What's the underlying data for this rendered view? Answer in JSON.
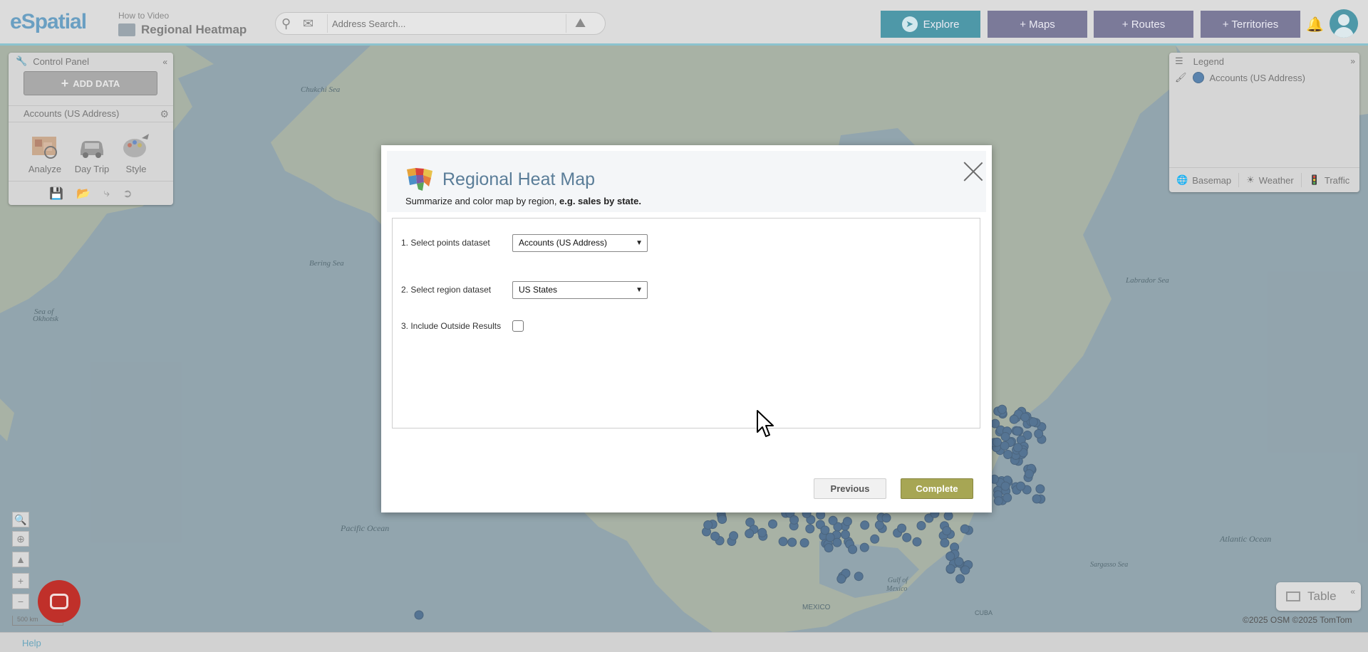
{
  "header": {
    "logo": "eSpatial",
    "video_subtitle": "How to Video",
    "video_title": "Regional Heatmap",
    "search_placeholder": "Address Search...",
    "nav": {
      "explore": "Explore",
      "maps": "+ Maps",
      "routes": "+ Routes",
      "territories": "+ Territories"
    }
  },
  "control_panel": {
    "title": "Control Panel",
    "add_data": "ADD DATA",
    "layer_name": "Accounts (US Address)",
    "tools": {
      "analyze": "Analyze",
      "day_trip": "Day Trip",
      "style": "Style"
    }
  },
  "legend": {
    "title": "Legend",
    "item_label": "Accounts (US Address)",
    "item_color": "#5a83ad",
    "footer": {
      "basemap": "Basemap",
      "weather": "Weather",
      "traffic": "Traffic"
    }
  },
  "map": {
    "labels": {
      "chukchi": "Chukchi Sea",
      "bering": "Bering Sea",
      "okhotsk_1": "Sea of",
      "okhotsk_2": "Okhotsk",
      "labrador": "Labrador Sea",
      "pacific": "Pacific Ocean",
      "atlantic": "Atlantic Ocean",
      "sargasso": "Sargasso Sea",
      "gulf_1": "Gulf of",
      "gulf_2": "Mexico",
      "mexico": "MEXICO",
      "cuba": "CUBA"
    },
    "scale": "500 km",
    "copyright": "©2025 OSM  ©2025 TomTom",
    "table_button": "Table",
    "help": "Help"
  },
  "modal": {
    "title": "Regional Heat Map",
    "subtitle_prefix": "Summarize and color map by region, ",
    "subtitle_bold": "e.g. sales by state.",
    "step1_label": "1. Select points dataset",
    "step1_value": "Accounts (US Address)",
    "step2_label": "2. Select region dataset",
    "step2_value": "US States",
    "step3_label": "3. Include Outside Results",
    "step3_checked": false,
    "previous": "Previous",
    "complete": "Complete"
  },
  "colors": {
    "accent": "#4e98a8",
    "nav_purple": "#7b7a99",
    "complete_button": "#a7a654",
    "title_blue": "#5a7d98"
  }
}
